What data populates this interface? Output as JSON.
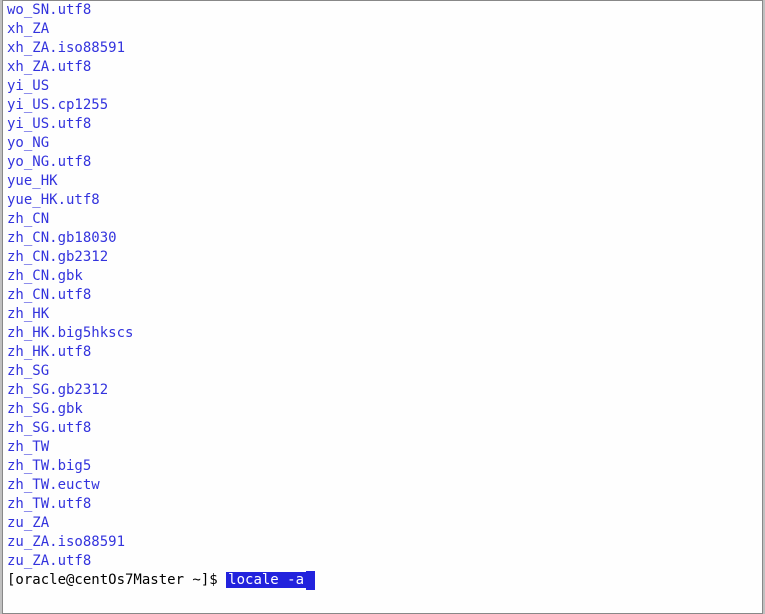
{
  "terminal": {
    "output_lines": [
      "wo_SN.utf8",
      "xh_ZA",
      "xh_ZA.iso88591",
      "xh_ZA.utf8",
      "yi_US",
      "yi_US.cp1255",
      "yi_US.utf8",
      "yo_NG",
      "yo_NG.utf8",
      "yue_HK",
      "yue_HK.utf8",
      "zh_CN",
      "zh_CN.gb18030",
      "zh_CN.gb2312",
      "zh_CN.gbk",
      "zh_CN.utf8",
      "zh_HK",
      "zh_HK.big5hkscs",
      "zh_HK.utf8",
      "zh_SG",
      "zh_SG.gb2312",
      "zh_SG.gbk",
      "zh_SG.utf8",
      "zh_TW",
      "zh_TW.big5",
      "zh_TW.euctw",
      "zh_TW.utf8",
      "zu_ZA",
      "zu_ZA.iso88591",
      "zu_ZA.utf8"
    ],
    "prompt": "[oracle@centOs7Master ~]$ ",
    "command": "locale -a",
    "cursor": " "
  }
}
